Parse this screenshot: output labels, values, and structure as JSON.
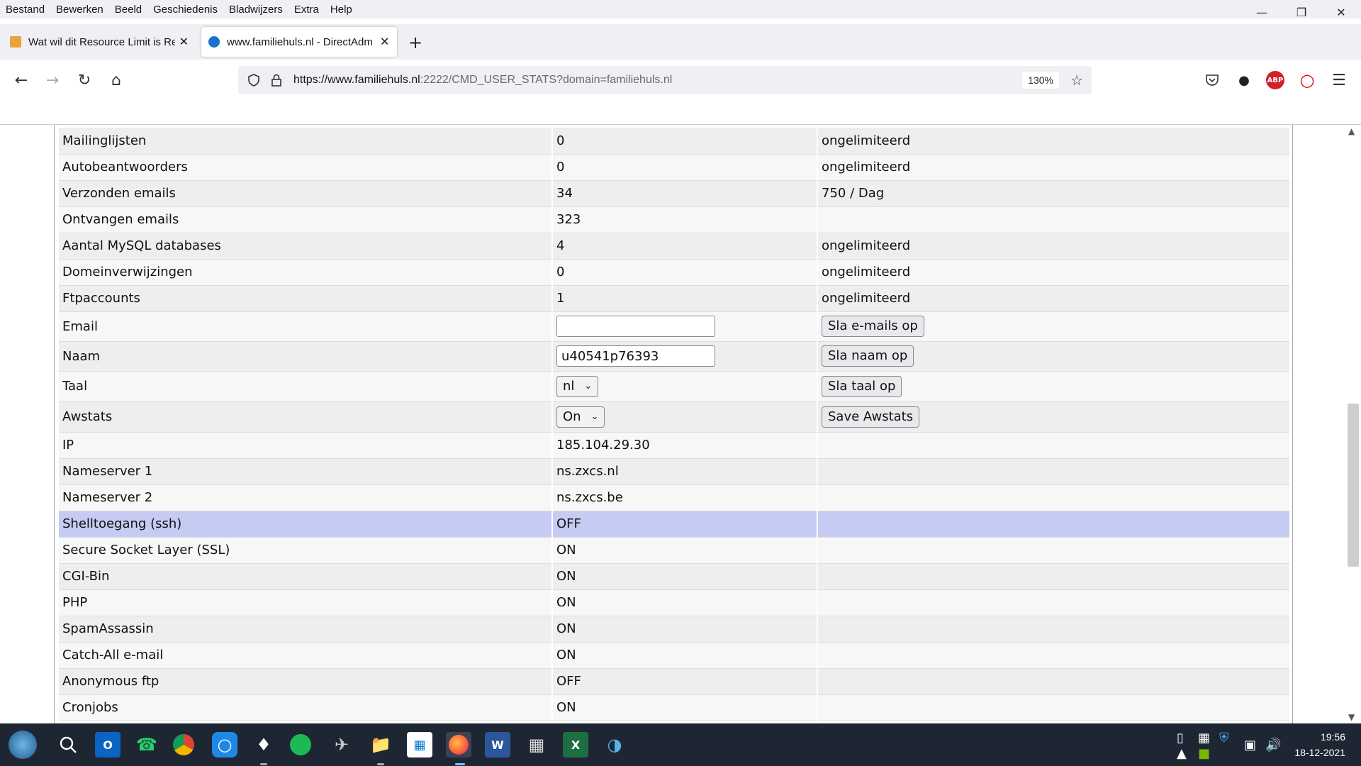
{
  "menu": [
    "Bestand",
    "Bewerken",
    "Beeld",
    "Geschiedenis",
    "Bladwijzers",
    "Extra",
    "Help"
  ],
  "tabs": [
    {
      "title": "Wat wil dit Resource Limit is Re",
      "active": false
    },
    {
      "title": "www.familiehuls.nl - DirectAdm",
      "active": true
    }
  ],
  "url": {
    "host": "https://www.familiehuls.nl",
    "rest": ":2222/CMD_USER_STATS?domain=familiehuls.nl"
  },
  "zoom": "130%",
  "extensions": {
    "abp": "ABP"
  },
  "rows": [
    {
      "label": "Mailinglijsten",
      "value": "0",
      "limit": "ongelimiteerd"
    },
    {
      "label": "Autobeantwoorders",
      "value": "0",
      "limit": "ongelimiteerd"
    },
    {
      "label": "Verzonden emails",
      "value": "34",
      "limit": "750 / Dag"
    },
    {
      "label": "Ontvangen emails",
      "value": "323",
      "limit": ""
    },
    {
      "label": "Aantal MySQL databases",
      "value": "4",
      "limit": "ongelimiteerd"
    },
    {
      "label": "Domeinverwijzingen",
      "value": "0",
      "limit": "ongelimiteerd"
    },
    {
      "label": "Ftpaccounts",
      "value": "1",
      "limit": "ongelimiteerd"
    }
  ],
  "form": {
    "email": {
      "label": "Email",
      "value": "",
      "button": "Sla e-mails op"
    },
    "naam": {
      "label": "Naam",
      "value": "u40541p76393",
      "button": "Sla naam op"
    },
    "taal": {
      "label": "Taal",
      "selected": "nl",
      "button": "Sla taal op"
    },
    "awstats": {
      "label": "Awstats",
      "selected": "On",
      "button": "Save Awstats"
    }
  },
  "info_rows": [
    {
      "label": "IP",
      "value": "185.104.29.30"
    },
    {
      "label": "Nameserver 1",
      "value": "ns.zxcs.nl"
    },
    {
      "label": "Nameserver 2",
      "value": "ns.zxcs.be"
    },
    {
      "label": "Shelltoegang (ssh)",
      "value": "OFF"
    },
    {
      "label": "Secure Socket Layer (SSL)",
      "value": "ON"
    },
    {
      "label": "CGI-Bin",
      "value": "ON"
    },
    {
      "label": "PHP",
      "value": "ON"
    },
    {
      "label": "SpamAssassin",
      "value": "ON"
    },
    {
      "label": "Catch-All e-mail",
      "value": "ON"
    },
    {
      "label": "Anonymous ftp",
      "value": "OFF"
    },
    {
      "label": "Cronjobs",
      "value": "ON"
    }
  ],
  "clock": {
    "time": "19:56",
    "date": "18-12-2021"
  },
  "colors": {
    "highlight": "#c5cbf2",
    "taskbar": "#1f2633"
  }
}
